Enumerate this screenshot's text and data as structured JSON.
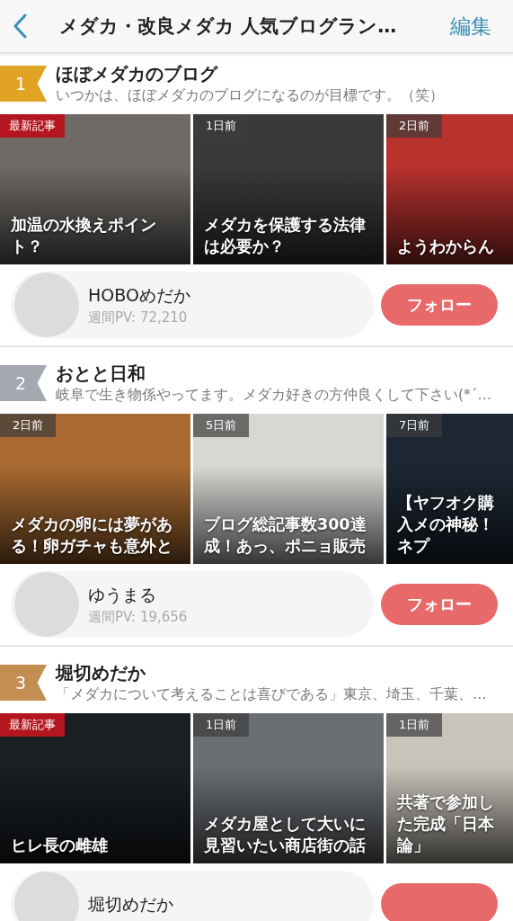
{
  "header": {
    "title": "メダカ・改良メダカ 人気ブログラン…",
    "edit": "編集"
  },
  "blogs": [
    {
      "rank": "1",
      "color": "#e0a323",
      "title": "ほぼメダカのブログ",
      "description": "いつかは、ほぼメダカのブログになるのが目標です。（笑）",
      "articles": [
        {
          "badge": "最新記事",
          "latest": true,
          "title": "加温の水換えポイント？"
        },
        {
          "badge": "1日前",
          "latest": false,
          "title": "メダカを保護する法律は必要か？"
        },
        {
          "badge": "2日前",
          "latest": false,
          "title": "ようわからん"
        }
      ],
      "author": {
        "name": "HOBOめだか",
        "pv": "週間PV: 72,210",
        "follow": "フォロー"
      }
    },
    {
      "rank": "2",
      "color": "#a4a9b0",
      "title": "おとと日和",
      "description": "岐阜で生き物係やってます。メダカ好きの方仲良くして下さい(*´…",
      "articles": [
        {
          "badge": "2日前",
          "latest": false,
          "title": "メダカの卵には夢がある！卵ガチャも意外と"
        },
        {
          "badge": "5日前",
          "latest": false,
          "title": "ブログ総記事数300達成！あっ、ポニョ販売"
        },
        {
          "badge": "7日前",
          "latest": false,
          "title": "【ヤフオク購入メの神秘！ネプ"
        }
      ],
      "author": {
        "name": "ゆうまる",
        "pv": "週間PV: 19,656",
        "follow": "フォロー"
      }
    },
    {
      "rank": "3",
      "color": "#c48d52",
      "title": "堀切めだか",
      "description": "「メダカについて考えることは喜びである」東京、埼玉、千葉、…",
      "articles": [
        {
          "badge": "最新記事",
          "latest": true,
          "title": "ヒレ長の雌雄"
        },
        {
          "badge": "1日前",
          "latest": false,
          "title": "メダカ屋として大いに見習いたい商店街の話"
        },
        {
          "badge": "1日前",
          "latest": false,
          "title": "共著で参加した完成「日本論」"
        }
      ],
      "author": {
        "name": "堀切めだか"
      }
    }
  ]
}
